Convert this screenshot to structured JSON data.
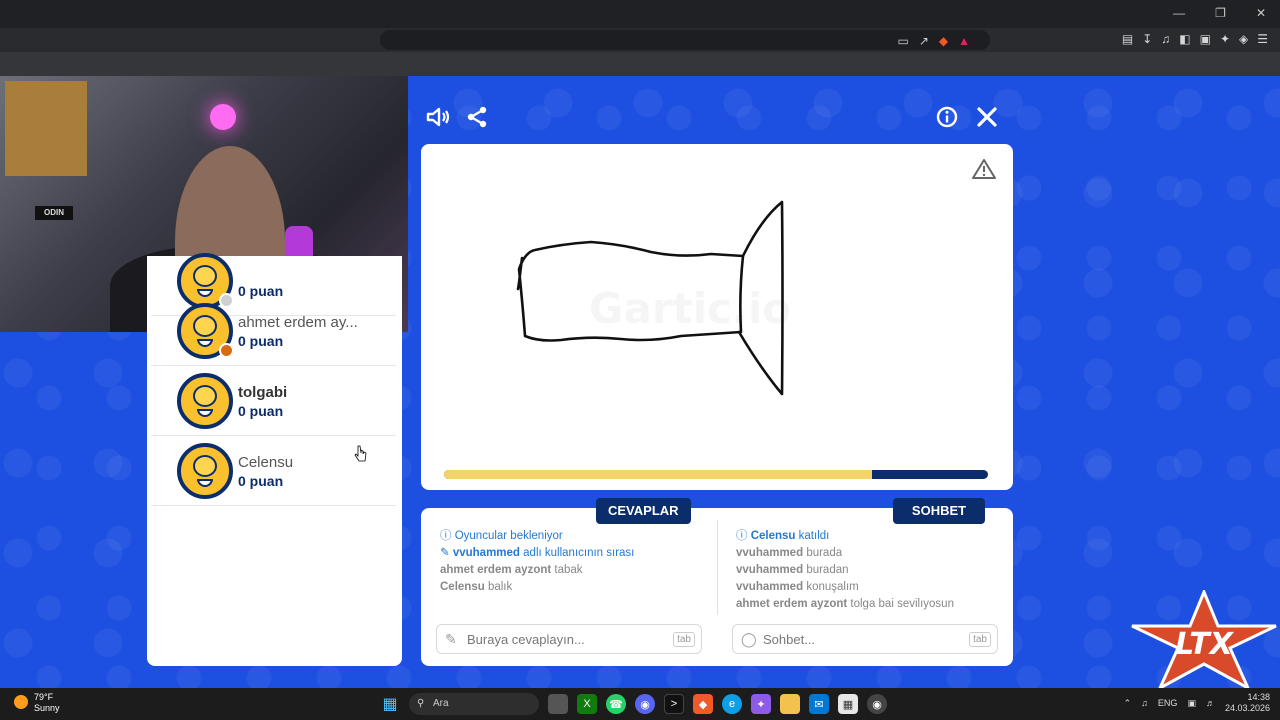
{
  "game": {
    "players": [
      {
        "name": "",
        "score": "0 puan",
        "badge_color": "#cfcfcf"
      },
      {
        "name": "ahmet erdem ay...",
        "score": "0 puan",
        "badge_color": "#d86b12"
      },
      {
        "name": "tolgabi",
        "score": "0 puan",
        "badge_color": ""
      },
      {
        "name": "Celensu",
        "score": "0 puan",
        "badge_color": ""
      }
    ],
    "progress_fraction": 0.79,
    "watermark": "Gartic.io",
    "answers_label": "CEVAPLAR",
    "chat_label": "SOHBET",
    "answers_feed": {
      "waiting": "Oyuncular bekleniyor",
      "turn_user": "vvuhammed",
      "turn_text": "adlı kullanıcının sırası",
      "guesses": [
        {
          "user": "ahmet erdem ayzont",
          "text": "tabak"
        },
        {
          "user": "Celensu",
          "text": "balık"
        }
      ]
    },
    "chat_feed": {
      "joined_user": "Celensu",
      "joined_text": "katıldı",
      "messages": [
        {
          "user": "vvuhammed",
          "text": "burada"
        },
        {
          "user": "vvuhammed",
          "text": "buradan"
        },
        {
          "user": "vvuhammed",
          "text": "konuşalım"
        },
        {
          "user": "ahmet erdem ayzont",
          "text": "tolga bai sevilıyosun"
        }
      ]
    },
    "answer_placeholder": "Buraya cevaplayın...",
    "chat_placeholder": "Sohbet...",
    "tab_hint": "tab"
  },
  "taskbar": {
    "weather_temp": "79°F",
    "weather_desc": "Sunny",
    "search_label": "Ara",
    "lang": "ENG",
    "time": "14:38",
    "date": "24.03.2026"
  },
  "colors": {
    "game_bg": "#1d4fe0",
    "navy": "#0c2d6b",
    "progress": "#f5d36b",
    "link_blue": "#2479d6"
  }
}
